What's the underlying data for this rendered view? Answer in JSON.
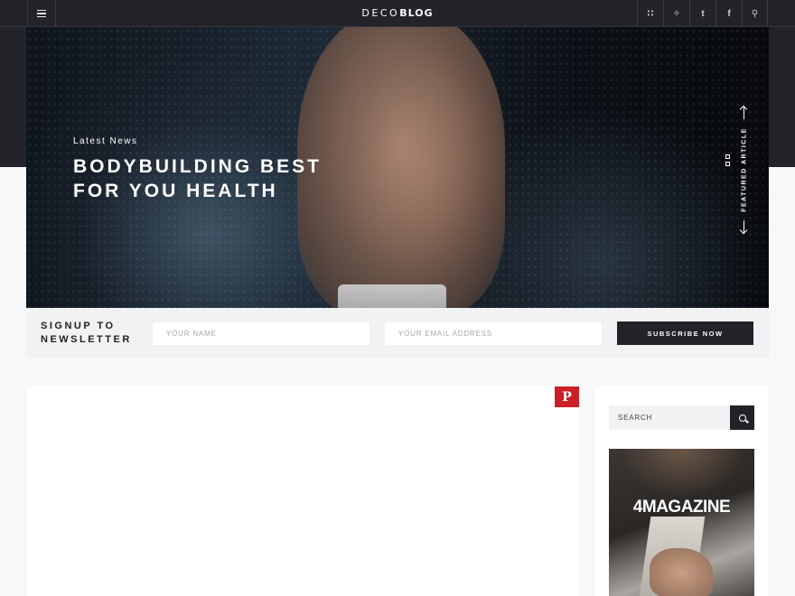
{
  "header": {
    "logo_light": "DECO",
    "logo_bold": "BLOG",
    "social": [
      {
        "icon": "rss-icon",
        "glyph": "∷"
      },
      {
        "icon": "twitter-icon",
        "glyph": "✧"
      },
      {
        "icon": "tumblr-icon",
        "glyph": "t"
      },
      {
        "icon": "facebook-icon",
        "glyph": "f"
      },
      {
        "icon": "search-icon",
        "glyph": "⚲"
      }
    ]
  },
  "hero": {
    "kicker": "Latest News",
    "title_line1": "BODYBUILDING BEST",
    "title_line2": "FOR YOU HEALTH",
    "featured_label": "FEATURED ARTICLE"
  },
  "newsletter": {
    "title_line1": "SIGNUP TO",
    "title_line2": "NEWSLETTER",
    "name_placeholder": "YOUR NAME",
    "email_placeholder": "YOUR EMAIL ADDRESS",
    "button_label": "SUBSCRIBE NOW"
  },
  "pin": {
    "glyph": "P",
    "color": "#cb2027"
  },
  "sidebar": {
    "search_placeholder": "SEARCH",
    "ad_title": "4MAGAZINE"
  }
}
